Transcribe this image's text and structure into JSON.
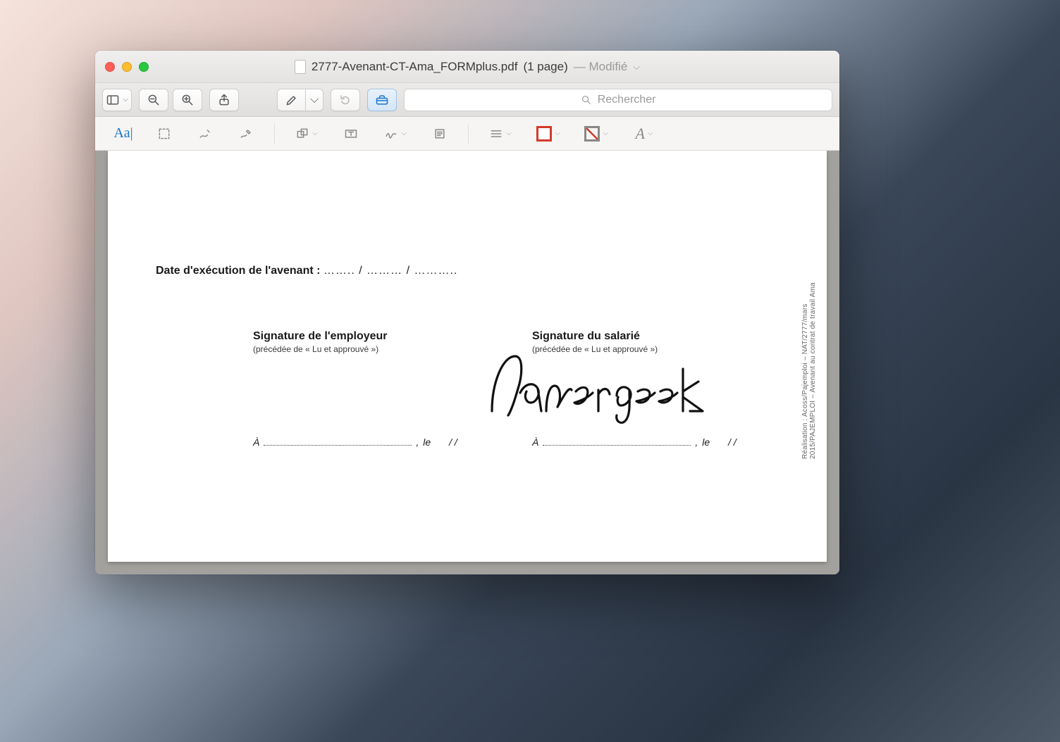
{
  "window": {
    "filename": "2777-Avenant-CT-Ama_FORMplus.pdf",
    "page_info": "(1 page)",
    "modified_label": "— Modifié"
  },
  "toolbar": {
    "search_placeholder": "Rechercher"
  },
  "document": {
    "date_label": "Date d'exécution de l'avenant :",
    "date_dots": "…….. / ……… / ………..",
    "employer": {
      "title": "Signature de l'employeur",
      "sub": "(précédée de « Lu et approuvé »)"
    },
    "employee": {
      "title": "Signature du salarié",
      "sub": "(précédée de « Lu et approuvé »)"
    },
    "place_prefix": "À",
    "date_prefix": "le",
    "date_slashes": "/      /",
    "side_text": "Réalisation : Acoss/Pajemploi – NAT/2777/mars 2015/PAJEMPLOI – Avenant au contrat de travail Ama",
    "signature_text": "Papergeek"
  }
}
